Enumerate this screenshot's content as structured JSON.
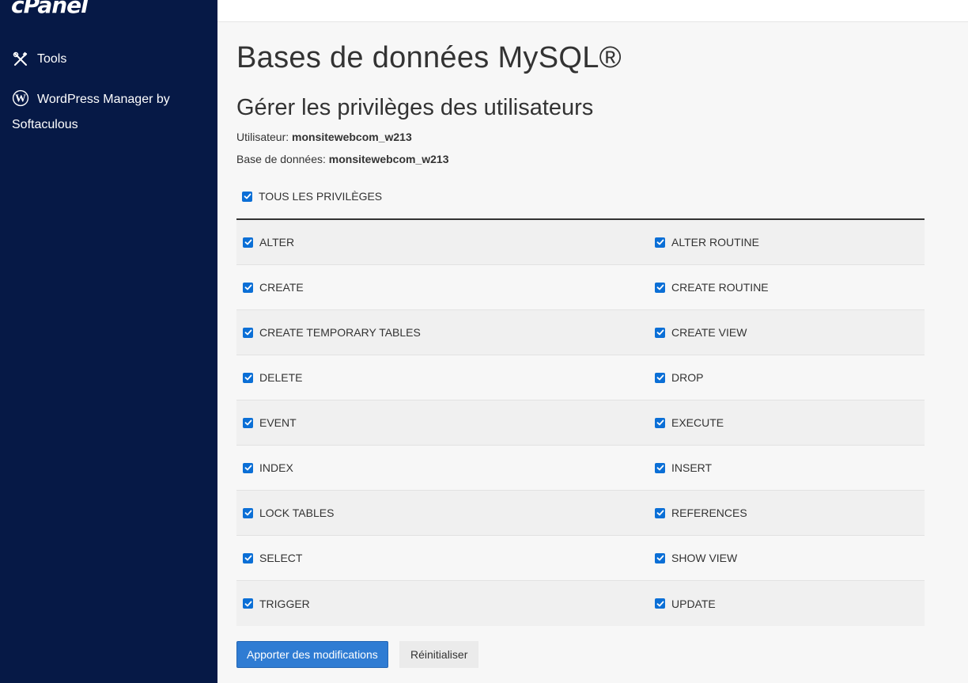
{
  "brand": {
    "logo_text": "cPanel",
    "sidebar_bg": "#061946",
    "accent": "#2f7cd3"
  },
  "sidebar": {
    "items": [
      {
        "label": "Tools",
        "icon": "tools-icon"
      },
      {
        "label": "WordPress Manager by Softaculous",
        "icon": "wordpress-icon"
      }
    ]
  },
  "page": {
    "title": "Bases de données MySQL®",
    "subtitle": "Gérer les privilèges des utilisateurs",
    "user_label": "Utilisateur:",
    "user_value": "monsitewebcom_w213",
    "db_label": "Base de données:",
    "db_value": "monsitewebcom_w213"
  },
  "privileges": {
    "all_label": "TOUS LES PRIVILÈGES",
    "all_checked": true,
    "rows": [
      {
        "left": "ALTER",
        "right": "ALTER ROUTINE"
      },
      {
        "left": "CREATE",
        "right": "CREATE ROUTINE"
      },
      {
        "left": "CREATE TEMPORARY TABLES",
        "right": "CREATE VIEW"
      },
      {
        "left": "DELETE",
        "right": "DROP"
      },
      {
        "left": "EVENT",
        "right": "EXECUTE"
      },
      {
        "left": "INDEX",
        "right": "INSERT"
      },
      {
        "left": "LOCK TABLES",
        "right": "REFERENCES"
      },
      {
        "left": "SELECT",
        "right": "SHOW VIEW"
      },
      {
        "left": "TRIGGER",
        "right": "UPDATE"
      }
    ]
  },
  "actions": {
    "apply_label": "Apporter des modifications",
    "reset_label": "Réinitialiser"
  }
}
